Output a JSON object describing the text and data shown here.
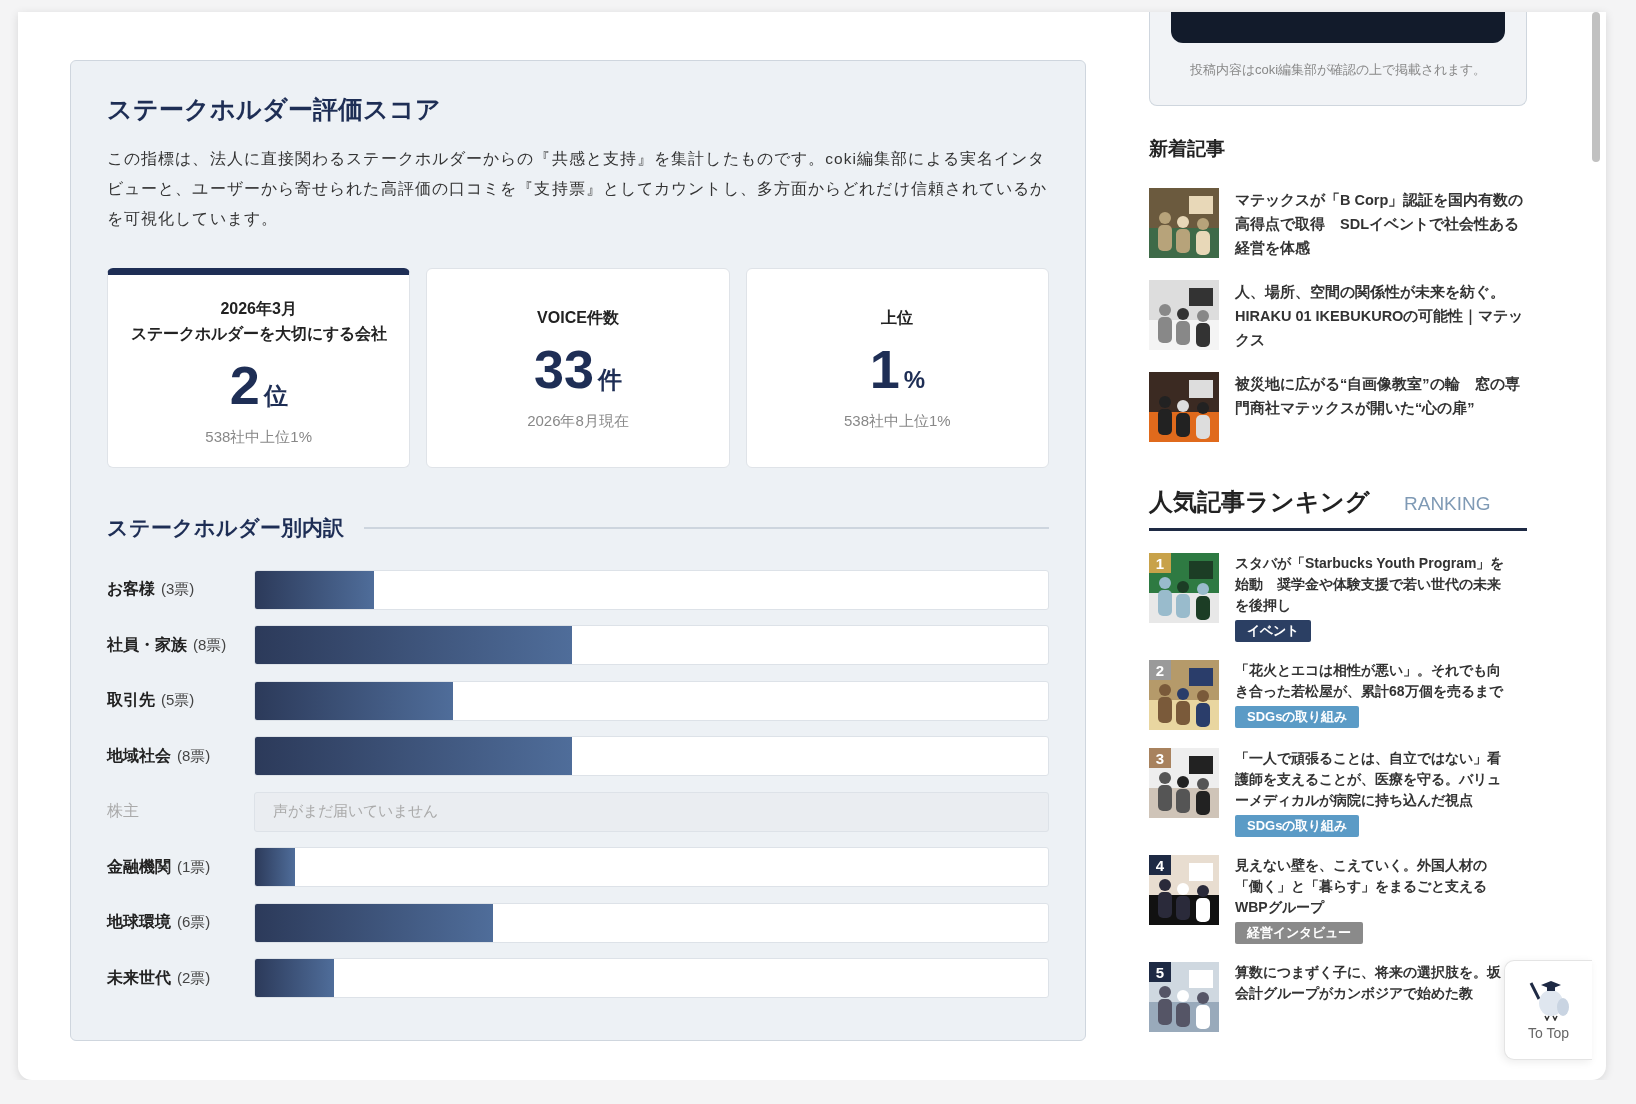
{
  "score": {
    "title": "ステークホルダー評価スコア",
    "description": "この指標は、法人に直接関わるステークホルダーからの『共感と支持』を集計したものです。coki編集部による実名インタビューと、ユーザーから寄せられた高評価の口コミを『支持票』としてカウントし、多方面からどれだけ信頼されているかを可視化しています。",
    "stats": [
      {
        "label_lines": [
          "2026年3月",
          "ステークホルダーを大切にする会社"
        ],
        "value": "2",
        "unit": "位",
        "note": "538社中上位1%",
        "highlighted": true
      },
      {
        "label_lines": [
          "VOICE件数"
        ],
        "value": "33",
        "unit": "件",
        "note": "2026年8月現在",
        "highlighted": false
      },
      {
        "label_lines": [
          "上位"
        ],
        "value": "1",
        "unit": "%",
        "note": "538社中上位1%",
        "highlighted": false
      }
    ],
    "breakdown_title": "ステークホルダー別内訳",
    "breakdown": [
      {
        "kind": "bar",
        "name": "お客様",
        "votes": "(3票)",
        "level": 0.15
      },
      {
        "kind": "bar",
        "name": "社員・家族",
        "votes": "(8票)",
        "level": 0.4
      },
      {
        "kind": "bar",
        "name": "取引先",
        "votes": "(5票)",
        "level": 0.25
      },
      {
        "kind": "bar",
        "name": "地域社会",
        "votes": "(8票)",
        "level": 0.4
      },
      {
        "kind": "empty",
        "name": "株主",
        "message": "声がまだ届いていません"
      },
      {
        "kind": "bar",
        "name": "金融機関",
        "votes": "(1票)",
        "level": 0.05
      },
      {
        "kind": "bar",
        "name": "地球環境",
        "votes": "(6票)",
        "level": 0.3
      },
      {
        "kind": "bar",
        "name": "未来世代",
        "votes": "(2票)",
        "level": 0.1
      }
    ]
  },
  "sidebar": {
    "post_note": "投稿内容はcoki編集部が確認の上で掲載されます。",
    "new_title": "新着記事",
    "new_articles": [
      {
        "title": "マテックスが「B Corp」認証を国内有数の高得点で取得　SDLイベントで社会性ある経営を体感"
      },
      {
        "title": "人、場所、空間の関係性が未来を紡ぐ。HIRAKU 01 IKEBUKUROの可能性｜マテックス"
      },
      {
        "title": "被災地に広がる“自画像教室”の輪　窓の専門商社マテックスが開いた“心の扉”"
      }
    ],
    "ranking_title": "人気記事ランキング",
    "ranking_label": "RANKING",
    "ranking": [
      {
        "rank": "1",
        "color": "#c8a24a",
        "title": "スタバが「Starbucks Youth Program」を始動　奨学金や体験支援で若い世代の未来を後押し",
        "tag": {
          "label": "イベント",
          "color": "#2b3f63"
        }
      },
      {
        "rank": "2",
        "color": "#9a9a9a",
        "title": "「花火とエコは相性が悪い」。それでも向き合った若松屋が、累計68万個を売るまで",
        "tag": {
          "label": "SDGsの取り組み",
          "color": "#5b9bc6"
        }
      },
      {
        "rank": "3",
        "color": "#a8825e",
        "title": "「一人で頑張ることは、自立ではない」看護師を支えることが、医療を守る。バリューメディカルが病院に持ち込んだ視点",
        "tag": {
          "label": "SDGsの取り組み",
          "color": "#5b9bc6"
        }
      },
      {
        "rank": "4",
        "color": "#1e2a44",
        "title": "見えない壁を、こえていく。外国人材の「働く」と「暮らす」をまるごと支えるWBPグループ",
        "tag": {
          "label": "経営インタビュー",
          "color": "#8a8a8a"
        }
      },
      {
        "rank": "5",
        "color": "#1e2a44",
        "title": "算数につまずく子に、将来の選択肢を。坂会計グループがカンボジアで始めた教"
      }
    ]
  },
  "to_top": {
    "label": "To Top"
  }
}
